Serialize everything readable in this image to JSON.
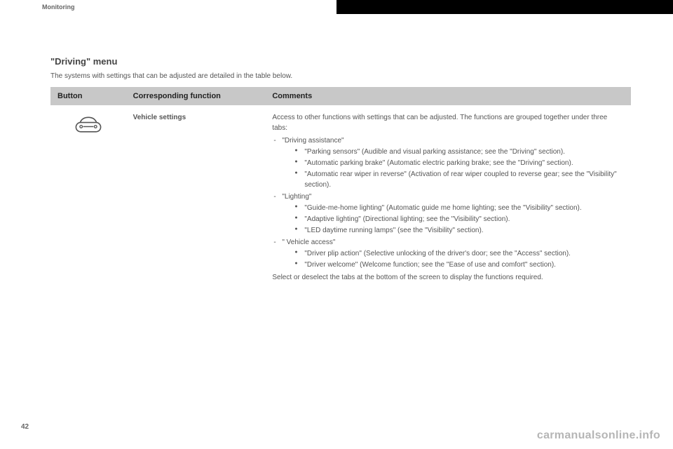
{
  "header": {
    "section": "Monitoring"
  },
  "page_number": "42",
  "watermark": "carmanualsonline.info",
  "menu": {
    "title": "\"Driving\" menu",
    "intro": "The systems with settings that can be adjusted are detailed in the table below."
  },
  "table": {
    "headers": {
      "button": "Button",
      "func": "Corresponding function",
      "comments": "Comments"
    },
    "row": {
      "icon_name": "car-icon",
      "function": "Vehicle settings",
      "comments_intro": "Access to other functions with settings that can be adjusted. The functions are grouped together under three tabs:",
      "tabs": [
        {
          "label": "\"Driving assistance\"",
          "items": [
            "\"Parking sensors\" (Audible and visual parking assistance; see the \"Driving\" section).",
            "\"Automatic parking brake\" (Automatic electric parking brake; see the \"Driving\" section).",
            "\"Automatic rear wiper in reverse\" (Activation of rear wiper coupled to reverse gear; see the \"Visibility\" section)."
          ]
        },
        {
          "label": "\"Lighting\"",
          "items": [
            "\"Guide-me-home lighting\" (Automatic guide me home lighting; see the \"Visibility\" section).",
            "\"Adaptive lighting\" (Directional lighting; see the \"Visibility\" section).",
            "\"LED daytime running lamps\" (see the \"Visibility\" section)."
          ]
        },
        {
          "label": "\" Vehicle access\"",
          "items": [
            "\"Driver plip action\" (Selective unlocking of the driver's door; see the \"Access\" section).",
            "\"Driver welcome\" (Welcome function; see the \"Ease of use and comfort\" section)."
          ]
        }
      ],
      "comments_outro": "Select or deselect the tabs at the bottom of the screen to display the functions required."
    }
  }
}
